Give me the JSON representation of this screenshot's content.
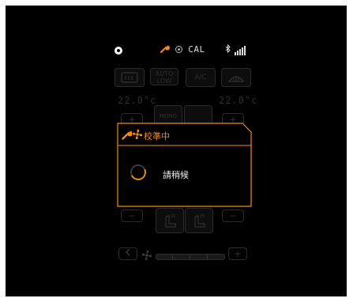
{
  "status": {
    "calibration_label": "CAL",
    "icons": [
      "circle-indicator-icon",
      "wrench-icon",
      "fan-icon",
      "bluetooth-icon",
      "signal-icon"
    ]
  },
  "climate": {
    "left_temp": "22.0°c",
    "right_temp": "22.0°c",
    "auto_label": "AUTO",
    "auto_sub": "LOW",
    "ac_label": "A/C",
    "mode_label": "MONO",
    "plus": "+",
    "minus": "−"
  },
  "dialog": {
    "title": "校準中",
    "message": "請稍候"
  },
  "colors": {
    "accent": "#f08a1c",
    "background": "#000000",
    "dim": "#2a2a2a"
  }
}
